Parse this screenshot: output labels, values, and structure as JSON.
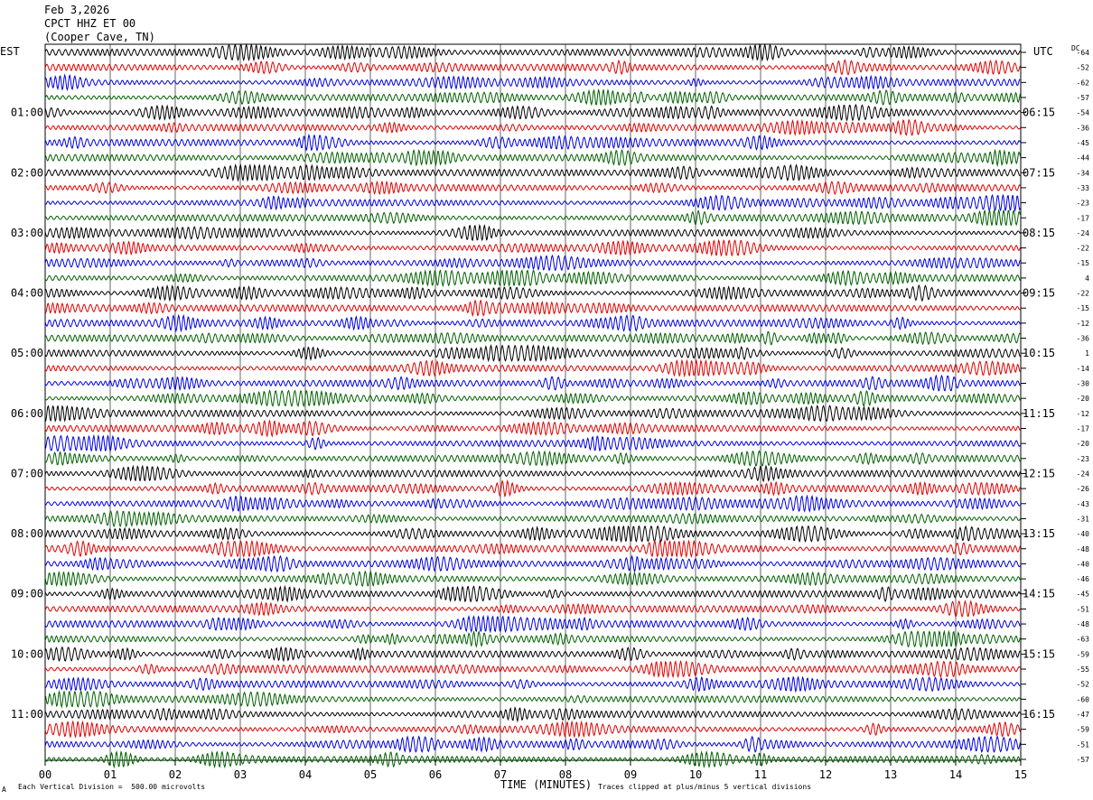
{
  "header": {
    "date": "Feb 3,2026",
    "station": "CPCT HHZ ET 00",
    "location": "(Cooper Cave, TN)"
  },
  "left_axis_title": "EST",
  "right_axis_title": "UTC",
  "dc_label": "DC",
  "footer": {
    "vertical_division": "Each Vertical Division =  500.00 microvolts",
    "xlabel": "TIME (MINUTES)",
    "clip_note": "Traces clipped at plus/minus 5 vertical divisions",
    "corner_mark": "A"
  },
  "colors": {
    "trace_cycle": [
      "#000000",
      "#e00000",
      "#0000e0",
      "#006000"
    ],
    "grid": "#000000",
    "background": "#ffffff"
  },
  "chart_data": {
    "type": "line",
    "description_kind": "helicorder",
    "x_ticks": [
      "00",
      "01",
      "02",
      "03",
      "04",
      "05",
      "06",
      "07",
      "08",
      "09",
      "10",
      "11",
      "12",
      "13",
      "14",
      "15"
    ],
    "xlim": [
      0,
      15
    ],
    "trace_count": 48,
    "minutes_per_trace": 15,
    "est_labels": [
      "01:00",
      "02:00",
      "03:00",
      "04:00",
      "05:00",
      "06:00",
      "07:00",
      "08:00",
      "09:00",
      "10:00",
      "11:00"
    ],
    "utc_labels": [
      "06:15",
      "07:15",
      "08:15",
      "09:15",
      "10:15",
      "11:15",
      "12:15",
      "13:15",
      "14:15",
      "15:15",
      "16:15"
    ],
    "dc_offsets": [
      "-64",
      "-52",
      "-62",
      "-57",
      "-54",
      "-36",
      "-45",
      "-44",
      "-34",
      "-33",
      "-23",
      "-17",
      "-24",
      "-22",
      "-15",
      "4",
      "-22",
      "-15",
      "-12",
      "-36",
      "1",
      "-14",
      "-30",
      "-20",
      "-12",
      "-17",
      "-20",
      "-23",
      "-24",
      "-26",
      "-43",
      "-31",
      "-40",
      "-48",
      "-40",
      "-46",
      "-45",
      "-51",
      "-48",
      "-63",
      "-59",
      "-55",
      "-52",
      "-60",
      "-47",
      "-59",
      "-51",
      "-57"
    ]
  }
}
